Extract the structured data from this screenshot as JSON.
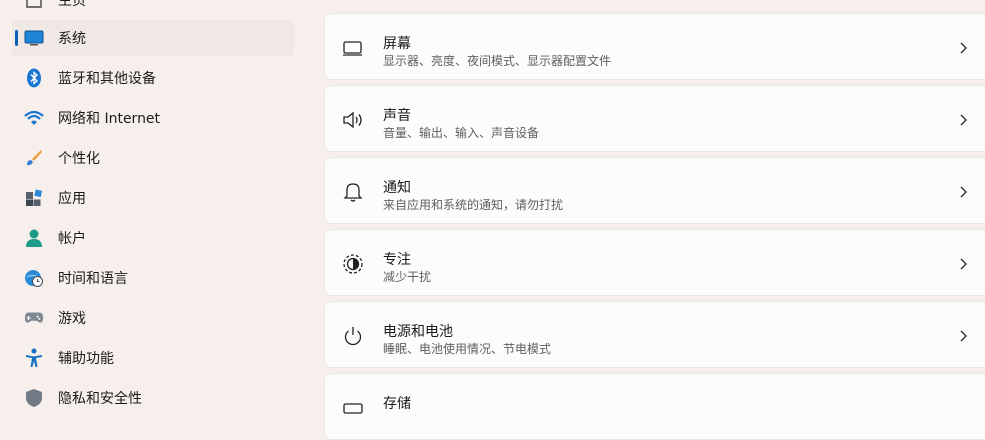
{
  "sidebar": {
    "items": [
      {
        "label": "主页",
        "icon": "home-icon"
      },
      {
        "label": "系统",
        "icon": "monitor-icon",
        "active": true
      },
      {
        "label": "蓝牙和其他设备",
        "icon": "bluetooth-icon"
      },
      {
        "label": "网络和 Internet",
        "icon": "wifi-icon"
      },
      {
        "label": "个性化",
        "icon": "paintbrush-icon"
      },
      {
        "label": "应用",
        "icon": "apps-icon"
      },
      {
        "label": "帐户",
        "icon": "account-icon"
      },
      {
        "label": "时间和语言",
        "icon": "globe-clock-icon"
      },
      {
        "label": "游戏",
        "icon": "gamepad-icon"
      },
      {
        "label": "辅助功能",
        "icon": "accessibility-icon"
      },
      {
        "label": "隐私和安全性",
        "icon": "shield-icon"
      }
    ]
  },
  "main": {
    "cards": [
      {
        "title": "屏幕",
        "subtitle": "显示器、亮度、夜间模式、显示器配置文件",
        "icon": "display-icon"
      },
      {
        "title": "声音",
        "subtitle": "音量、输出、输入、声音设备",
        "icon": "speaker-icon"
      },
      {
        "title": "通知",
        "subtitle": "来自应用和系统的通知，请勿打扰",
        "icon": "bell-icon"
      },
      {
        "title": "专注",
        "subtitle": "减少干扰",
        "icon": "focus-icon"
      },
      {
        "title": "电源和电池",
        "subtitle": "睡眠、电池使用情况、节电模式",
        "icon": "power-icon"
      },
      {
        "title": "存储",
        "subtitle": "",
        "icon": "storage-icon"
      }
    ]
  },
  "colors": {
    "accent": "#0a5fb8",
    "background": "#f7efeb",
    "card": "#fdfcfc"
  }
}
